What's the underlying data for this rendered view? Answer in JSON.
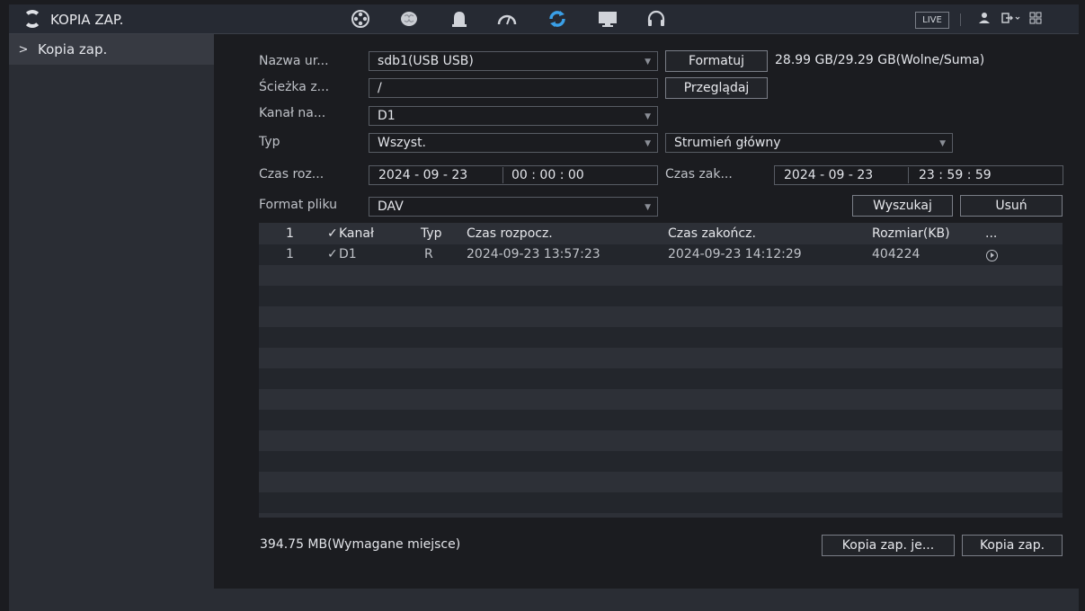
{
  "app": {
    "title": "KOPIA ZAP."
  },
  "topbar": {
    "icons": [
      "film-reel-icon",
      "brain-icon",
      "alarm-bell-icon",
      "speedometer-icon",
      "backup-sync-icon",
      "monitor-icon",
      "headset-icon"
    ],
    "active_icon": "backup-sync-icon",
    "live_label": "LIVE",
    "user_icon": "user-icon",
    "logout_icon": "logout-icon",
    "grid_icon": "grid-icon"
  },
  "sidebar": {
    "items": [
      {
        "label": "Kopia zap.",
        "chevron": ">"
      }
    ]
  },
  "form": {
    "device_label": "Nazwa ur...",
    "device_value": "sdb1(USB USB)",
    "format_button": "Formatuj",
    "capacity": "28.99 GB/29.29 GB(Wolne/Suma)",
    "path_label": "Ścieżka z...",
    "path_value": "/",
    "browse_button": "Przeglądaj",
    "channel_label": "Kanał na...",
    "channel_value": "D1",
    "type_label": "Typ",
    "type_value": "Wszyst.",
    "stream_value": "Strumień główny",
    "start_label": "Czas roz...",
    "start_date": "2024 - 09 - 23",
    "start_time": "00 : 00 : 00",
    "end_label": "Czas zak...",
    "end_date": "2024 - 09 - 23",
    "end_time": "23 : 59 : 59",
    "format_label": "Format pliku",
    "format_value": "DAV",
    "search_button": "Wyszukaj",
    "delete_button": "Usuń"
  },
  "table": {
    "headers": {
      "index": "1",
      "check": "✓",
      "channel": "Kanał",
      "type": "Typ",
      "start": "Czas rozpocz.",
      "end": "Czas zakończ.",
      "size": "Rozmiar(KB)",
      "more": "..."
    },
    "rows": [
      {
        "index": "1",
        "check": "✓",
        "channel": "D1",
        "type": "R",
        "start": "2024-09-23 13:57:23",
        "end": "2024-09-23 14:12:29",
        "size": "404224",
        "action_icon": "play-icon"
      }
    ]
  },
  "footer": {
    "required_space": "394.75 MB(Wymagane miejsce)",
    "backup_enc_button": "Kopia zap. je...",
    "backup_button": "Kopia zap."
  },
  "colors": {
    "background": "#1b1c20",
    "panel": "#2a2d34",
    "accent": "#3aa0e8"
  }
}
